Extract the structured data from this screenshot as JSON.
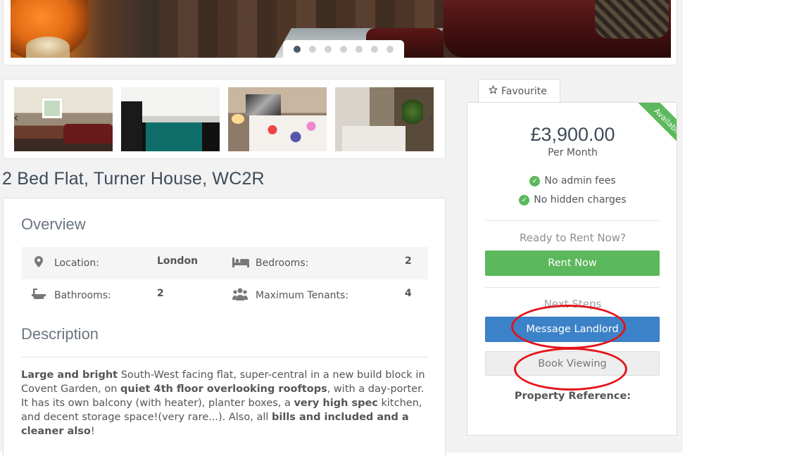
{
  "hero": {
    "slide_count": 7,
    "active_slide": 1
  },
  "gallery": {
    "prev_arrow": "‹",
    "next_arrow": "›"
  },
  "listing": {
    "title": "2 Bed Flat, Turner House, WC2R"
  },
  "overview": {
    "heading": "Overview",
    "location_label": "Location:",
    "location_value": "London",
    "bedrooms_label": "Bedrooms:",
    "bedrooms_value": "2",
    "bathrooms_label": "Bathrooms:",
    "bathrooms_value": "2",
    "tenants_label": "Maximum Tenants:",
    "tenants_value": "4"
  },
  "description": {
    "heading": "Description",
    "p1_b1": "Large and bright",
    "p1_t1": " South-West facing flat, super-central in a new build block in Covent Garden, on ",
    "p1_b2": "quiet 4th floor overlooking rooftops",
    "p1_t2": ", with a day-porter.",
    "p2_t1": "It has its own balcony (with heater), planter boxes, a ",
    "p2_b1": "very high spec",
    "p2_t2": " kitchen, and decent storage space!(very rare...). Also, all ",
    "p2_b2": "bills and included and a cleaner also",
    "p2_t3": "!"
  },
  "sidebar": {
    "favourite_label": "Favourite",
    "ribbon": "Available",
    "price": "£3,900.00",
    "period": "Per Month",
    "feature1": "No admin fees",
    "feature2": "No hidden charges",
    "ready_text": "Ready to Rent Now?",
    "rent_button": "Rent Now",
    "next_steps": "Next Steps",
    "message_button": "Message Landlord",
    "book_button": "Book Viewing",
    "ref_label": "Property Reference:"
  },
  "colors": {
    "accent_green": "#5cb85c",
    "primary_blue": "#3c82c8",
    "annotation_red": "#e3141a"
  },
  "icons": {
    "location": "map-pin-icon",
    "bedrooms": "bed-icon",
    "bathrooms": "bath-icon",
    "tenants": "users-icon",
    "favourite": "star-outline-icon",
    "check": "check-circle-icon"
  }
}
